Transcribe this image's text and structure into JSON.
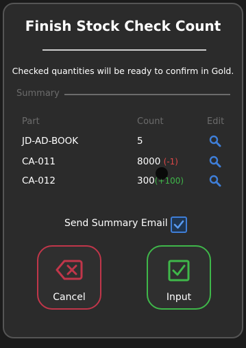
{
  "dialog": {
    "title": "Finish Stock Check Count",
    "message": "Checked quantities will be ready to confirm in Gold."
  },
  "summary": {
    "section_label": "Summary",
    "headers": {
      "part": "Part",
      "count": "Count",
      "edit": "Edit"
    },
    "rows": [
      {
        "part": "JD-AD-BOOK",
        "count": "5",
        "delta": ""
      },
      {
        "part": "CA-011",
        "count": "8000",
        "delta": "(-1)"
      },
      {
        "part": "CA-012",
        "count": "300",
        "delta": "(+100)"
      }
    ]
  },
  "email": {
    "label": "Send Summary Email",
    "checked": true
  },
  "actions": {
    "cancel_label": "Cancel",
    "input_label": "Input"
  },
  "colors": {
    "cancel": "#c1364a",
    "input": "#3fb84a",
    "delta_negative": "#e04848",
    "delta_positive": "#3fb84a",
    "accent": "#3f7fd9"
  },
  "icons": {
    "edit": "search-icon",
    "cancel": "backspace-x-icon",
    "input": "check-square-icon",
    "email": "checkmark-icon"
  }
}
